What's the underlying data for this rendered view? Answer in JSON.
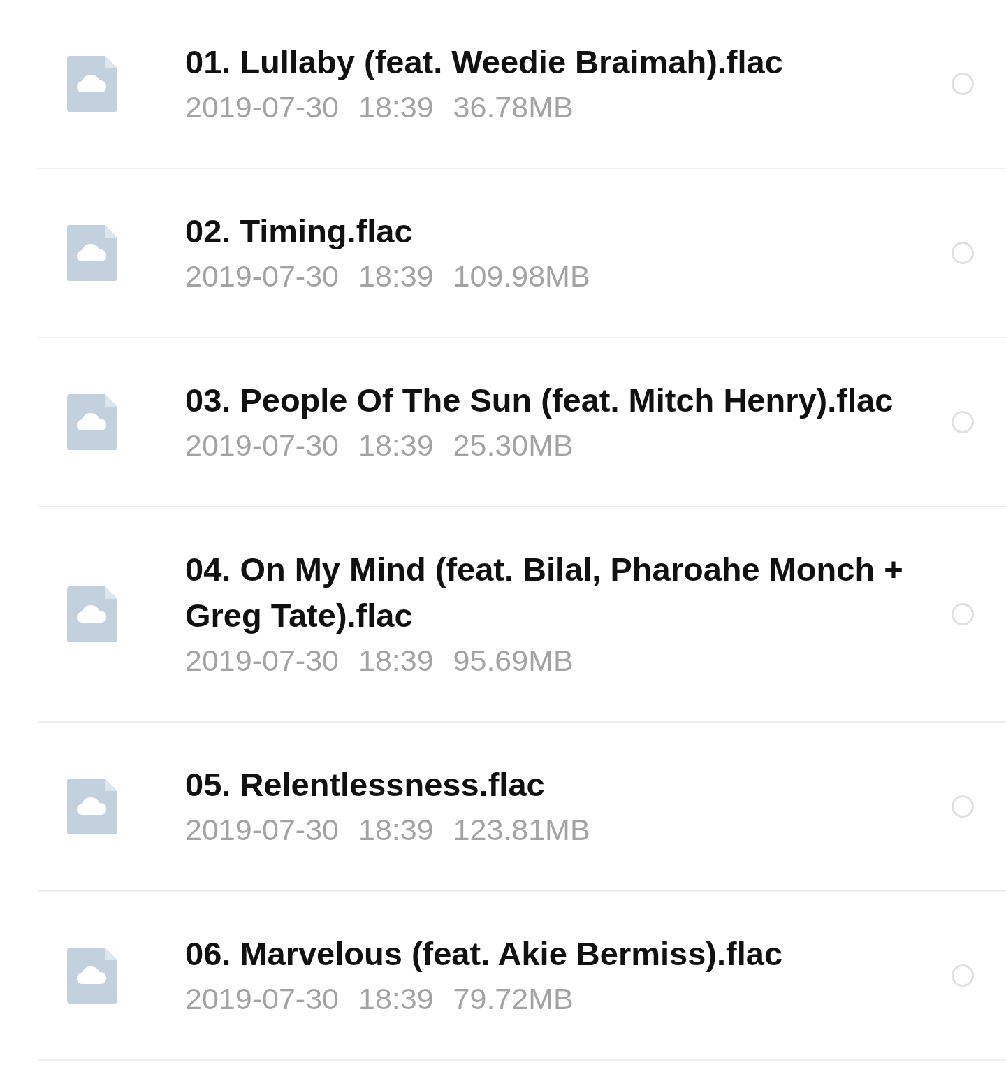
{
  "files": [
    {
      "name": "01. Lullaby (feat. Weedie Braimah).flac",
      "date": "2019-07-30",
      "time": "18:39",
      "size": "36.78MB",
      "selected": false
    },
    {
      "name": "02. Timing.flac",
      "date": "2019-07-30",
      "time": "18:39",
      "size": "109.98MB",
      "selected": false
    },
    {
      "name": "03. People Of The Sun (feat. Mitch Henry).flac",
      "date": "2019-07-30",
      "time": "18:39",
      "size": "25.30MB",
      "selected": false
    },
    {
      "name": "04. On My Mind (feat. Bilal, Pharoahe Monch + Greg Tate).flac",
      "date": "2019-07-30",
      "time": "18:39",
      "size": "95.69MB",
      "selected": false
    },
    {
      "name": "05. Relentlessness.flac",
      "date": "2019-07-30",
      "time": "18:39",
      "size": "123.81MB",
      "selected": false
    },
    {
      "name": "06. Marvelous (feat. Akie Bermiss).flac",
      "date": "2019-07-30",
      "time": "18:39",
      "size": "79.72MB",
      "selected": false
    }
  ]
}
